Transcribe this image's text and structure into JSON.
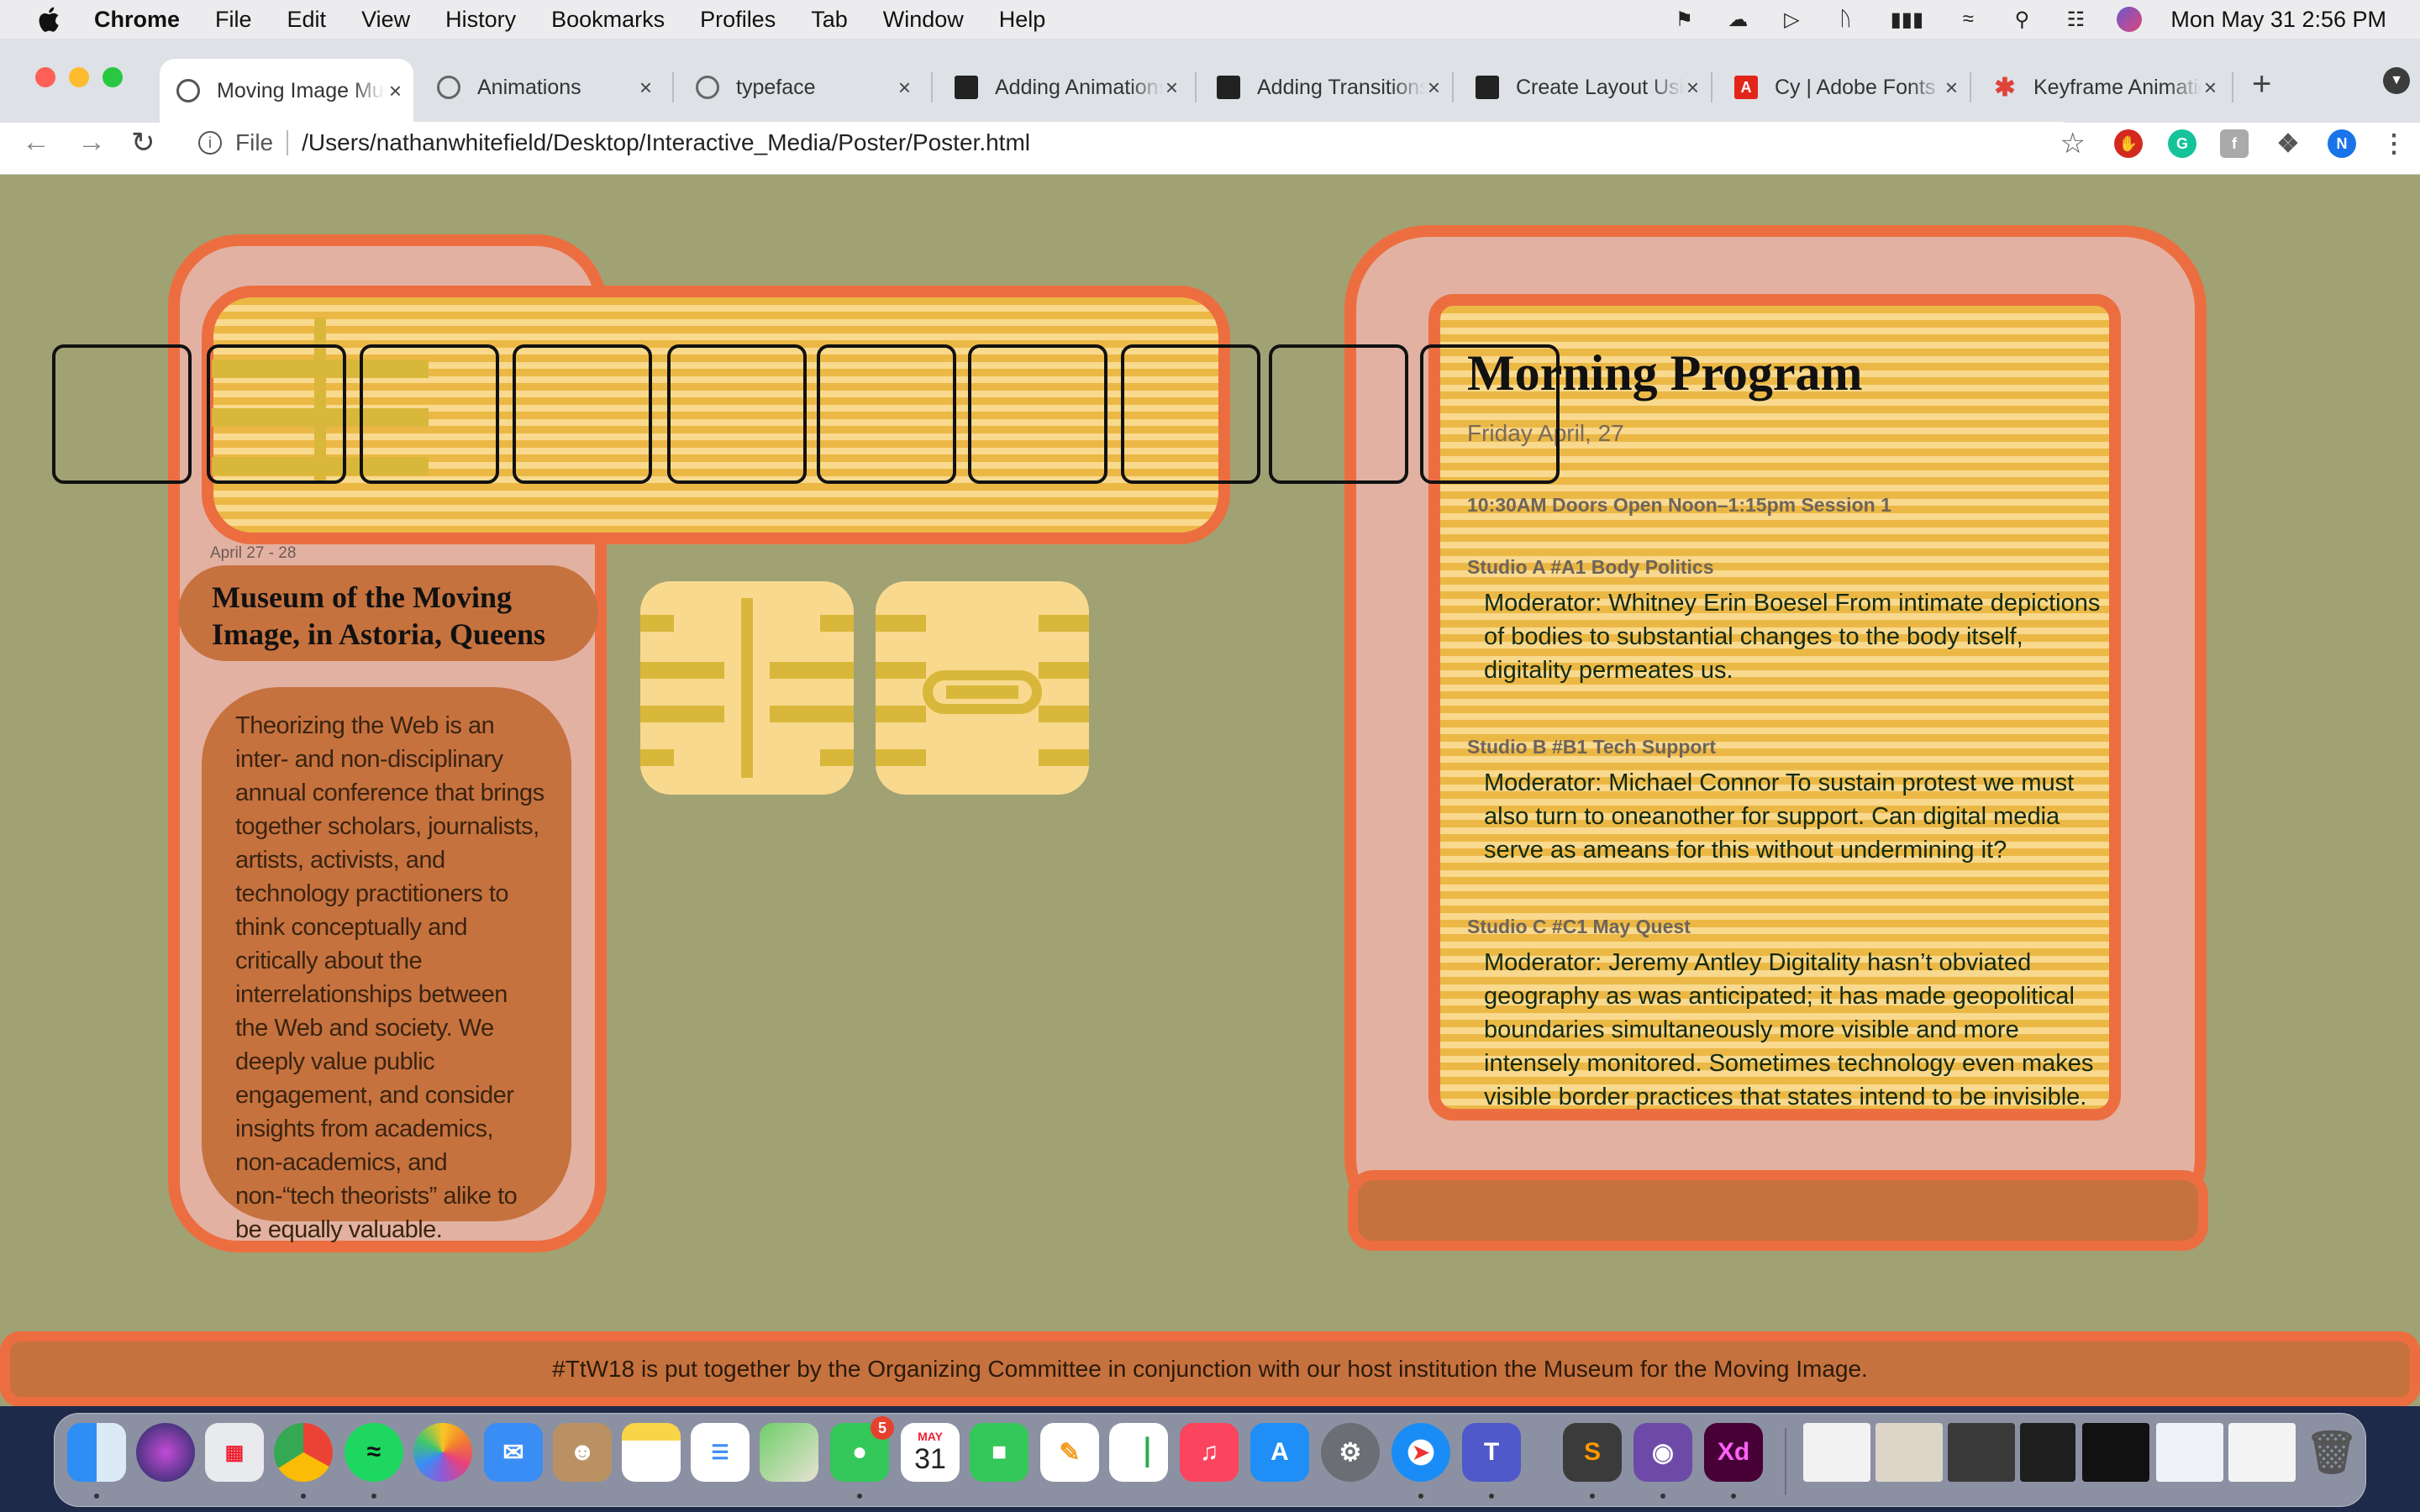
{
  "menubar": {
    "app_name": "Chrome",
    "items": [
      "File",
      "Edit",
      "View",
      "History",
      "Bookmarks",
      "Profiles",
      "Tab",
      "Window",
      "Help"
    ],
    "clock": "Mon May 31  2:56 PM"
  },
  "tabs": [
    {
      "label": "Moving Image Museum"
    },
    {
      "label": "Animations"
    },
    {
      "label": "typeface"
    },
    {
      "label": "Adding Animations"
    },
    {
      "label": "Adding Transitions"
    },
    {
      "label": "Create Layout Using"
    },
    {
      "label": "Cy | Adobe Fonts"
    },
    {
      "label": "Keyframe Animations"
    }
  ],
  "omnibox": {
    "scheme": "File",
    "url": "/Users/nathanwhitefield/Desktop/Interactive_Media/Poster/Poster.html"
  },
  "profile_initial": "N",
  "poster": {
    "date_range": "April 27 - 28",
    "venue": "Museum of the Moving Image, in Astoria, Queens",
    "about": "Theorizing the Web is an inter- and non-disciplinary annual conference that brings together scholars, journalists, artists, activists, and technology practitioners to think conceptually and critically about the interrelationships between the Web and society. We deeply value public engagement, and consider insights from academics, non-academics, and non-“tech theorists” alike to be equally valuable.",
    "program": {
      "title": "Morning Program",
      "date": "Friday April, 27",
      "hours": "10:30AM Doors Open Noon–1:15pm Session 1",
      "sessions": [
        {
          "studio": "Studio A #A1 Body Politics",
          "desc": "Moderator: Whitney Erin Boesel From intimate depictions of bodies to substantial changes to the body itself, digitality permeates us."
        },
        {
          "studio": "Studio B #B1 Tech Support",
          "desc": "Moderator: Michael Connor To sustain protest we must also turn to oneanother for support. Can digital media serve as ameans for this without undermining it?"
        },
        {
          "studio": "Studio C #C1 May Quest",
          "desc": "Moderator: Jeremy Antley Digitality hasn’t obviated geography as was anticipated; it has made geopolitical boundaries simultaneously more visible and more intensely monitored. Sometimes technology even makes visible border practices that states intend to be invisible."
        }
      ]
    },
    "footer": "#TtW18 is put together by the Organizing Committee in conjunction with our host institution the Museum for the Moving Image."
  },
  "dock": {
    "calendar_month": "MAY",
    "calendar_day": "31",
    "messages_badge": "5"
  },
  "colors": {
    "page_bg": "#a0a274",
    "accent_orange": "#ec6e40",
    "rust": "#c6723f",
    "blush": "#e2b1a2",
    "stripe_gold": "#ecb845",
    "stripe_light": "#f8d98e"
  }
}
